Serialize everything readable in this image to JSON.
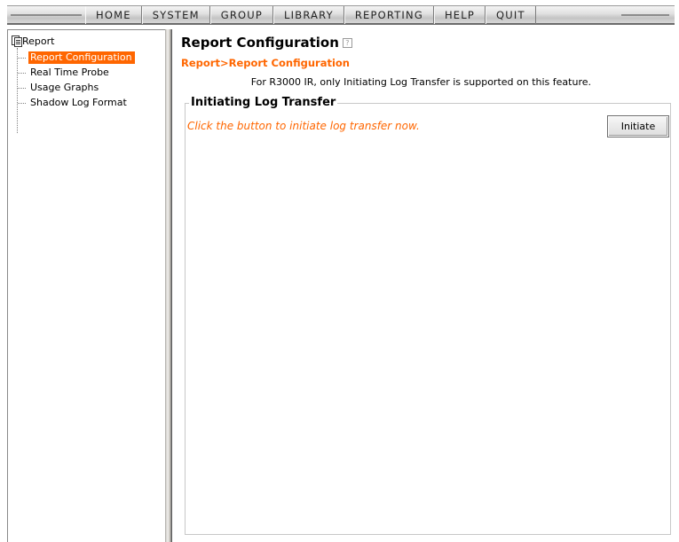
{
  "nav": {
    "items": [
      "HOME",
      "SYSTEM",
      "GROUP",
      "LIBRARY",
      "REPORTING",
      "HELP",
      "QUIT"
    ]
  },
  "sidebar": {
    "root_label": "Report",
    "items": [
      {
        "label": "Report Configuration",
        "selected": true
      },
      {
        "label": "Real Time Probe",
        "selected": false
      },
      {
        "label": "Usage Graphs",
        "selected": false
      },
      {
        "label": "Shadow Log Format",
        "selected": false
      }
    ]
  },
  "main": {
    "title": "Report Configuration",
    "help_icon": "?",
    "breadcrumb": "Report>Report Configuration",
    "notice": "For R3000 IR, only Initiating Log Transfer is supported on this feature.",
    "section": {
      "legend": "Initiating Log Transfer",
      "instruction": "Click the button to initiate log transfer now.",
      "button_label": "Initiate"
    }
  },
  "colors": {
    "accent": "#ff6600",
    "selected_text": "#ffffff"
  }
}
